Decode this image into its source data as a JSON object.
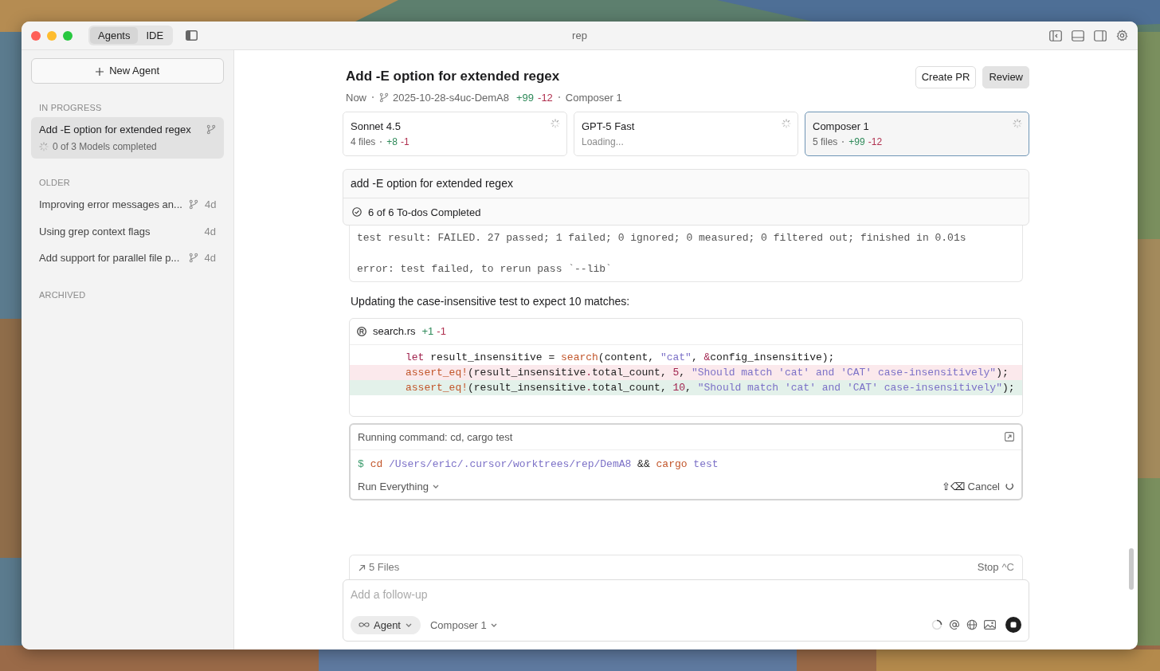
{
  "window": {
    "title": "rep"
  },
  "mode_tabs": [
    {
      "label": "Agents",
      "selected": true
    },
    {
      "label": "IDE",
      "selected": false
    }
  ],
  "sidebar": {
    "new_button": "New Agent",
    "sections": [
      {
        "heading": "IN PROGRESS",
        "items": [
          {
            "title": "Add -E option for extended regex",
            "subtitle": "0 of 3 Models completed",
            "branch": true,
            "selected": true
          }
        ]
      },
      {
        "heading": "OLDER",
        "items": [
          {
            "title": "Improving error messages an...",
            "age": "4d",
            "branch": true,
            "selected": false
          },
          {
            "title": "Using grep context flags",
            "age": "4d",
            "branch": false,
            "selected": false
          },
          {
            "title": "Add support for parallel file p...",
            "age": "4d",
            "branch": true,
            "selected": false
          }
        ]
      },
      {
        "heading": "ARCHIVED"
      }
    ]
  },
  "header": {
    "title": "Add -E option for extended regex",
    "time": "Now",
    "branch": "2025-10-28-s4uc-DemA8",
    "added": "+99",
    "removed": "-12",
    "model": "Composer 1",
    "buttons": [
      {
        "label": "Create PR",
        "kind": "outline"
      },
      {
        "label": "Review",
        "kind": "filled"
      }
    ]
  },
  "models": [
    {
      "name": "Sonnet 4.5",
      "files": "4 files",
      "added": "+8",
      "removed": "-1",
      "selected": false
    },
    {
      "name": "GPT-5 Fast",
      "status": "Loading...",
      "selected": false
    },
    {
      "name": "Composer 1",
      "files": "5 files",
      "added": "+99",
      "removed": "-12",
      "selected": true
    }
  ],
  "prompt": "add -E option for extended regex",
  "todos": "6 of 6 To-dos Completed",
  "output_paragraphs": [
    "test result: FAILED. 27 passed; 1 failed; 0 ignored; 0 measured; 0 filtered out; finished in 0.01s",
    "error: test failed, to rerun pass `--lib`"
  ],
  "message": "Updating the case-insensitive test to expect 10 matches:",
  "diff": {
    "file": "search.rs",
    "added": "+1",
    "removed": "-1",
    "lines": [
      {
        "removed": false,
        "added": false,
        "tokens": [
          {
            "text": "let",
            "kind": "keyword"
          },
          {
            "text": " result_insensitive = ",
            "kind": "plain"
          },
          {
            "text": "search",
            "kind": "fn"
          },
          {
            "text": "(content, ",
            "kind": "plain"
          },
          {
            "text": "\"cat\"",
            "kind": "string"
          },
          {
            "text": ", ",
            "kind": "plain"
          },
          {
            "text": "&",
            "kind": "keyword"
          },
          {
            "text": "config_insensitive);",
            "kind": "plain"
          }
        ]
      },
      {
        "removed": true,
        "added": false,
        "tokens": [
          {
            "text": "assert_eq!",
            "kind": "fn"
          },
          {
            "text": "(result_insensitive",
            "kind": "plain"
          },
          {
            "text": ".",
            "kind": "keyword"
          },
          {
            "text": "total_count, ",
            "kind": "plain"
          },
          {
            "text": "5",
            "kind": "number"
          },
          {
            "text": ", ",
            "kind": "plain"
          },
          {
            "text": "\"Should match 'cat' and 'CAT' case-insensitively\"",
            "kind": "string"
          },
          {
            "text": ");",
            "kind": "plain"
          }
        ]
      },
      {
        "removed": false,
        "added": true,
        "tokens": [
          {
            "text": "assert_eq!",
            "kind": "fn"
          },
          {
            "text": "(result_insensitive",
            "kind": "plain"
          },
          {
            "text": ".",
            "kind": "keyword"
          },
          {
            "text": "total_count, ",
            "kind": "plain"
          },
          {
            "text": "10",
            "kind": "number"
          },
          {
            "text": ", ",
            "kind": "plain"
          },
          {
            "text": "\"Should match 'cat' and 'CAT' case-insensitively\"",
            "kind": "string"
          },
          {
            "text": ");",
            "kind": "plain"
          }
        ]
      }
    ]
  },
  "command": {
    "title": "Running command: cd, cargo test",
    "tokens": [
      {
        "text": "$",
        "kind": "prompt"
      },
      {
        "text": "cd",
        "kind": "fn"
      },
      {
        "text": "/Users/eric/.cursor/worktrees/rep/DemA8",
        "kind": "string"
      },
      {
        "text": "&&",
        "kind": "plain"
      },
      {
        "text": "cargo",
        "kind": "fn"
      },
      {
        "text": "test",
        "kind": "string"
      }
    ],
    "run_mode": "Run Everything",
    "shortcut": "⇧⌫",
    "cancel": "Cancel"
  },
  "files_bar": {
    "label": "5 Files",
    "stop": "Stop",
    "shortcut": "^C"
  },
  "composer": {
    "placeholder": "Add a follow-up",
    "mode": "Agent",
    "model": "Composer 1"
  }
}
